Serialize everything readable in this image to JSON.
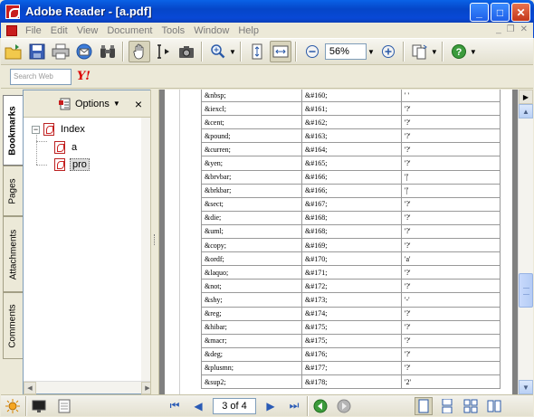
{
  "window": {
    "title": "Adobe Reader - [a.pdf]",
    "minimize": "_",
    "maximize": "□",
    "close": "✕"
  },
  "menu": [
    "File",
    "Edit",
    "View",
    "Document",
    "Tools",
    "Window",
    "Help"
  ],
  "menu_right": {
    "minimize": "_",
    "restore": "❐",
    "close": "✕"
  },
  "toolbar": {
    "zoom_value": "56%"
  },
  "search": {
    "placeholder": "Search Web",
    "brand": "Y!"
  },
  "tabs": [
    "Bookmarks",
    "Pages",
    "Attachments",
    "Comments"
  ],
  "bookmarks_panel": {
    "options_label": "Options",
    "close_label": "×",
    "tree": [
      {
        "label": "Index",
        "expander": "−"
      },
      {
        "label": "a"
      },
      {
        "label": "pro"
      }
    ]
  },
  "document": {
    "rows": [
      [
        "&nbsp;",
        "&#160;",
        "' '"
      ],
      [
        "&iexcl;",
        "&#161;",
        "'?'"
      ],
      [
        "&cent;",
        "&#162;",
        "'?'"
      ],
      [
        "&pound;",
        "&#163;",
        "'?'"
      ],
      [
        "&curren;",
        "&#164;",
        "'?'"
      ],
      [
        "&yen;",
        "&#165;",
        "'?'"
      ],
      [
        "&brvbar;",
        "&#166;",
        "'|'"
      ],
      [
        "&brkbar;",
        "&#166;",
        "'|'"
      ],
      [
        "&sect;",
        "&#167;",
        "'?'"
      ],
      [
        "&die;",
        "&#168;",
        "'?'"
      ],
      [
        "&uml;",
        "&#168;",
        "'?'"
      ],
      [
        "&copy;",
        "&#169;",
        "'?'"
      ],
      [
        "&ordf;",
        "&#170;",
        "'a'"
      ],
      [
        "&laquo;",
        "&#171;",
        "'?'"
      ],
      [
        "&not;",
        "&#172;",
        "'?'"
      ],
      [
        "&shy;",
        "&#173;",
        "'-'"
      ],
      [
        "&reg;",
        "&#174;",
        "'?'"
      ],
      [
        "&hibar;",
        "&#175;",
        "'?'"
      ],
      [
        "&macr;",
        "&#175;",
        "'?'"
      ],
      [
        "&deg;",
        "&#176;",
        "'?'"
      ],
      [
        "&plusmn;",
        "&#177;",
        "'?'"
      ],
      [
        "&sup2;",
        "&#178;",
        "'2'"
      ]
    ]
  },
  "statusbar": {
    "page_indicator": "3 of 4"
  },
  "colors": {
    "titlebar": "#0848d6",
    "workspace": "#808080",
    "chrome": "#ece9d8"
  }
}
